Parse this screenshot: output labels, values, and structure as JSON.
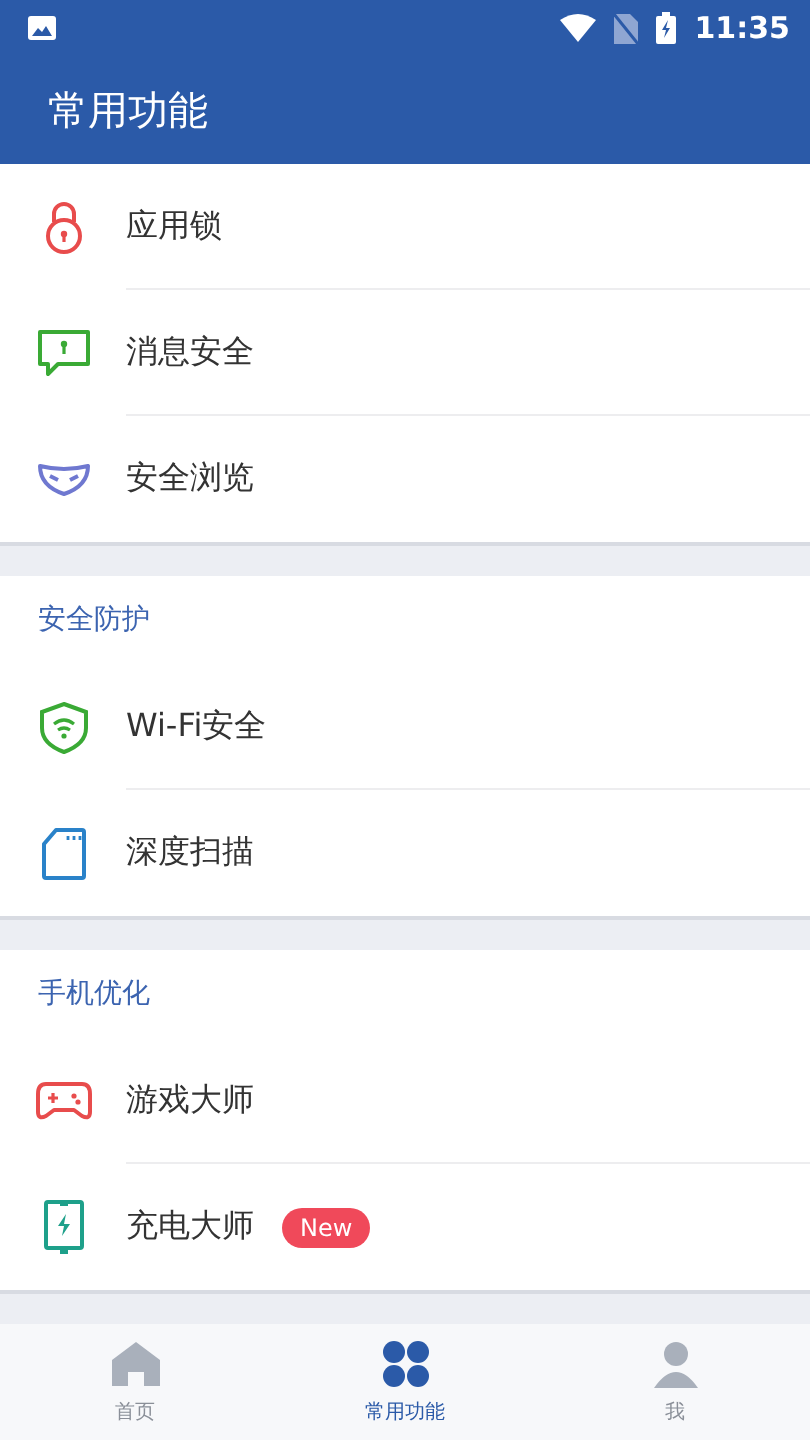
{
  "status_bar": {
    "time": "11:35"
  },
  "app_bar": {
    "title": "常用功能"
  },
  "sections": [
    {
      "items": [
        {
          "kind": "lock",
          "label": "应用锁"
        },
        {
          "kind": "message",
          "label": "消息安全"
        },
        {
          "kind": "mask",
          "label": "安全浏览"
        }
      ]
    },
    {
      "header": "安全防护",
      "items": [
        {
          "kind": "shield",
          "label": "Wi-Fi安全"
        },
        {
          "kind": "card",
          "label": "深度扫描"
        }
      ]
    },
    {
      "header": "手机优化",
      "items": [
        {
          "kind": "gamepad",
          "label": "游戏大师"
        },
        {
          "kind": "charge",
          "label": "充电大师",
          "badge": "New"
        }
      ]
    }
  ],
  "bottom_nav": [
    {
      "kind": "home",
      "label": "首页",
      "selected": false
    },
    {
      "kind": "grid",
      "label": "常用功能",
      "selected": true
    },
    {
      "kind": "me",
      "label": "我",
      "selected": false
    }
  ]
}
